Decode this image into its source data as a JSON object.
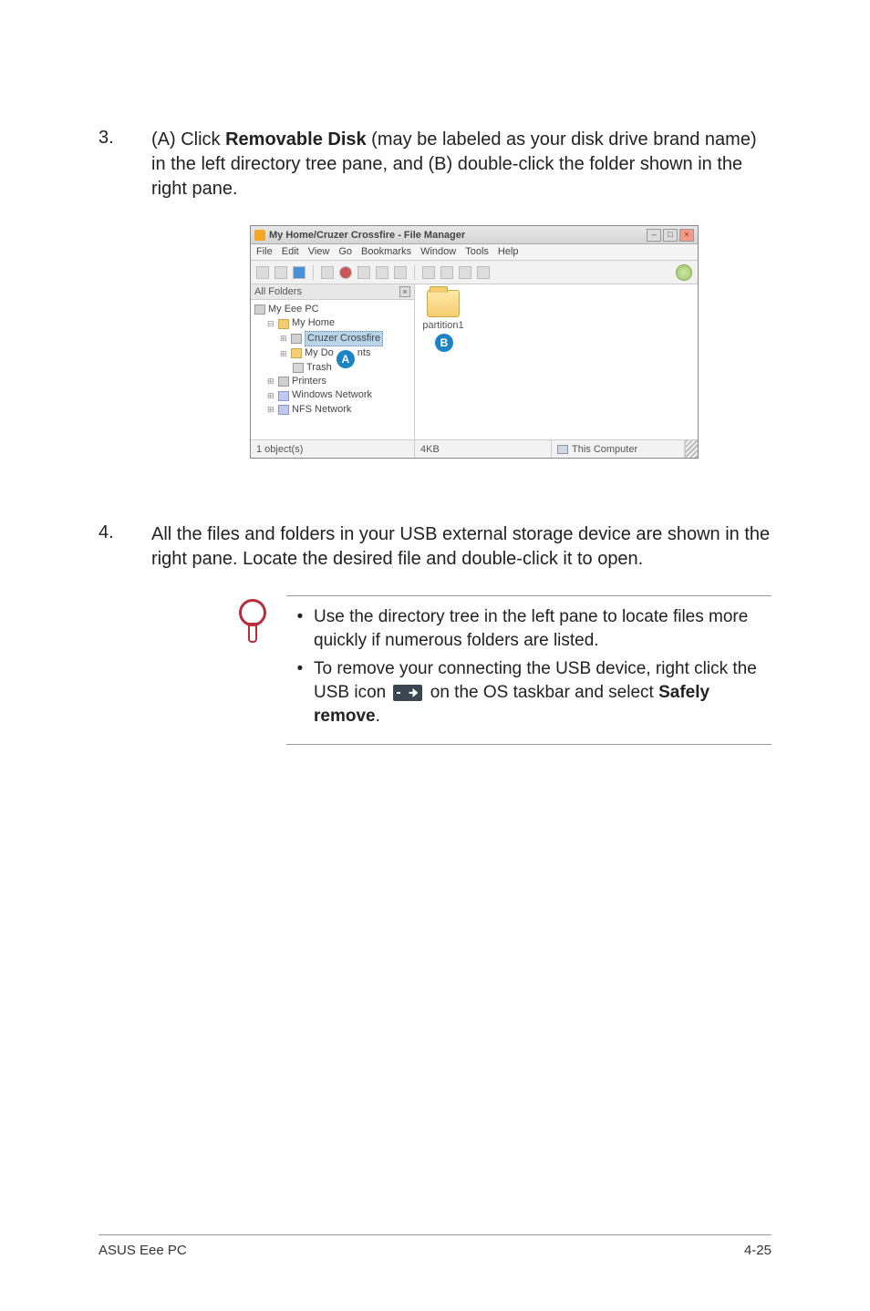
{
  "step3": {
    "num": "3.",
    "text_prefix": "(A) Click ",
    "bold": "Removable Disk",
    "text_suffix": " (may be labeled as your disk drive brand name) in the left directory tree pane, and (B) double-click the folder shown in the right pane."
  },
  "fm": {
    "title": "My Home/Cruzer Crossfire - File Manager",
    "menus": [
      "File",
      "Edit",
      "View",
      "Go",
      "Bookmarks",
      "Window",
      "Tools",
      "Help"
    ],
    "tree_header": "All Folders",
    "tree": {
      "root": "My Eee PC",
      "home": "My Home",
      "removable": "Cruzer Crossfire",
      "docs_prefix": "My Do",
      "docs_suffix": "nts",
      "trash": "Trash",
      "printers": "Printers",
      "winnet": "Windows Network",
      "nfsnet": "NFS Network"
    },
    "folder_name": "partition1",
    "status": {
      "objects": "1 object(s)",
      "size": "4KB",
      "location": "This Computer"
    },
    "marker_a": "A",
    "marker_b": "B"
  },
  "step4": {
    "num": "4.",
    "text": "All the files and folders in your USB external storage device are shown in the right pane. Locate the desired file and double-click it to open."
  },
  "notes": {
    "n1": "Use the directory tree in the left pane to locate files more quickly if numerous folders are listed.",
    "n2_prefix": "To remove your connecting the USB device, right click the USB icon ",
    "n2_mid": " on the OS taskbar and select ",
    "n2_bold": "Safely remove",
    "n2_end": "."
  },
  "footer": {
    "left": "ASUS Eee PC",
    "right": "4-25"
  }
}
